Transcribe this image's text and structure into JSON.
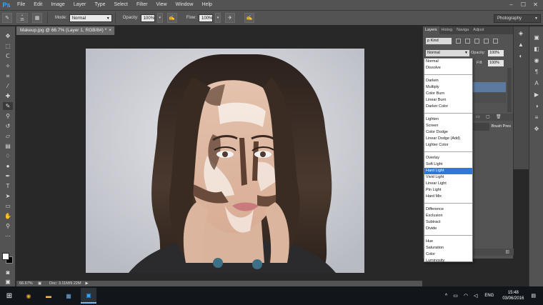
{
  "app": {
    "logo": "Ps"
  },
  "menu": [
    "File",
    "Edit",
    "Image",
    "Layer",
    "Type",
    "Select",
    "Filter",
    "View",
    "Window",
    "Help"
  ],
  "window_controls": {
    "minimize": "–",
    "maximize": "☐",
    "close": "✕"
  },
  "options_bar": {
    "brush_size": "35",
    "mode_label": "Mode:",
    "mode_value": "Normal",
    "opacity_label": "Opacity:",
    "opacity_value": "100%",
    "flow_label": "Flow:",
    "flow_value": "100%",
    "workspace": "Photography"
  },
  "document": {
    "tab_title": "Makeup.jpg @ 66.7% (Layer 1, RGB/8#) *",
    "tab_close": "×",
    "zoom": "66.67%",
    "doc_size": "Doc: 3.11M/9.22M"
  },
  "layers_panel": {
    "tabs": [
      "Layers",
      "Histog",
      "Naviga",
      "Adjust"
    ],
    "kind": "ρ Kind",
    "blend_mode": "Normal",
    "opacity_label": "Opacity:",
    "opacity_value": "100%",
    "fill_label": "Fill:",
    "fill_value": "100%"
  },
  "brush_panel": {
    "tabs": [
      "Brush Pres"
    ]
  },
  "blend_menu": {
    "groups": [
      [
        "Normal",
        "Dissolve"
      ],
      [
        "Darken",
        "Multiply",
        "Color Burn",
        "Linear Burn",
        "Darker Color"
      ],
      [
        "Lighten",
        "Screen",
        "Color Dodge",
        "Linear Dodge (Add)",
        "Lighter Color"
      ],
      [
        "Overlay",
        "Soft Light",
        "Hard Light",
        "Vivid Light",
        "Linear Light",
        "Pin Light",
        "Hard Mix"
      ],
      [
        "Difference",
        "Exclusion",
        "Subtract",
        "Divide"
      ],
      [
        "Hue",
        "Saturation",
        "Color",
        "Luminosity"
      ]
    ],
    "selected": "Hard Light"
  },
  "taskbar": {
    "language": "ENG",
    "time": "15:48",
    "date": "03/06/2016"
  },
  "colors": {
    "ui_dark": "#535353",
    "workspace_bg": "#282828",
    "accent": "#2f7ad8",
    "photoshop_blue": "#31a8ff",
    "foreground_swatch": "#ffffff",
    "background_swatch": "#000000"
  }
}
